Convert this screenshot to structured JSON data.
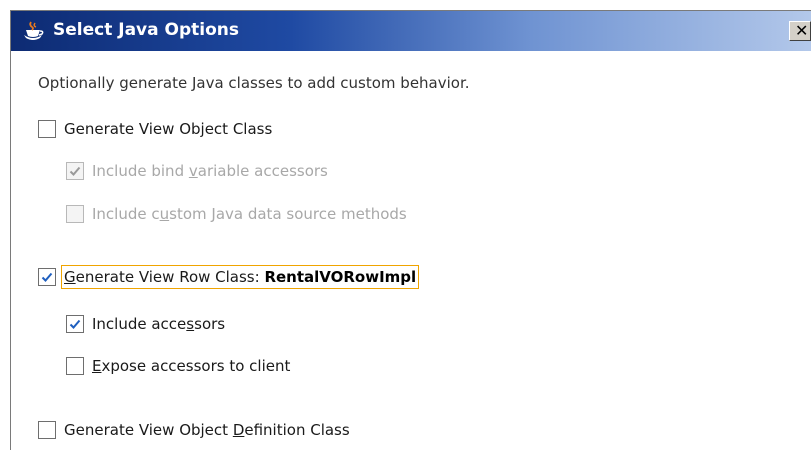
{
  "window": {
    "title": "Select Java Options",
    "close_glyph": "✕"
  },
  "description": "Optionally generate Java classes to add custom behavior.",
  "options": [
    {
      "pre": "Generate View Ob",
      "mn": "j",
      "post": "ect Class",
      "checked": false,
      "enabled": true
    },
    {
      "pre": "Include bind ",
      "mn": "v",
      "post": "ariable accessors",
      "checked": true,
      "enabled": false
    },
    {
      "pre": "Include c",
      "mn": "u",
      "post": "stom Java data source methods",
      "checked": false,
      "enabled": false
    },
    {
      "pre": "",
      "mn": "G",
      "post": "enerate View Row Class: ",
      "suffix": "RentalVORowImpl",
      "checked": true,
      "enabled": true,
      "focused": true
    },
    {
      "pre": "Include acce",
      "mn": "s",
      "post": "sors",
      "checked": true,
      "enabled": true
    },
    {
      "pre": "",
      "mn": "E",
      "post": "xpose accessors to client",
      "checked": false,
      "enabled": true
    },
    {
      "pre": "Generate View Object ",
      "mn": "D",
      "post": "efinition Class",
      "checked": false,
      "enabled": true
    }
  ],
  "colors": {
    "check_mark": "#1f5fbf",
    "check_mark_disabled": "#9a9a9a",
    "focus_outline": "#f0a400"
  }
}
